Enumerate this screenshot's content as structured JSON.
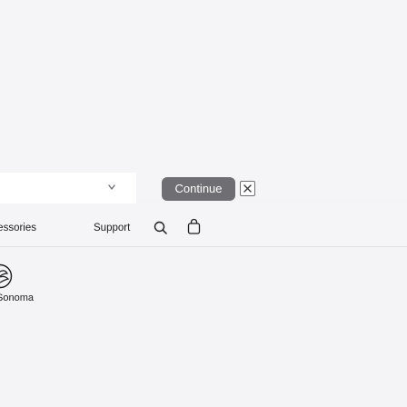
{
  "locale_banner": {
    "continue_label": "Continue",
    "select_icon": "chevron-down-icon",
    "close_icon": "close-icon"
  },
  "nav": {
    "items": [
      {
        "label": "Accessories"
      },
      {
        "label": "Support"
      }
    ],
    "search_icon": "search-icon",
    "bag_icon": "shopping-bag-icon"
  },
  "products": [
    {
      "label": "Sonoma",
      "icon": "macos-sonoma-icon"
    }
  ],
  "colors": {
    "button_bg": "#6e6e73",
    "nav_bg": "#f5f5f7",
    "text": "#1d1d1f"
  }
}
